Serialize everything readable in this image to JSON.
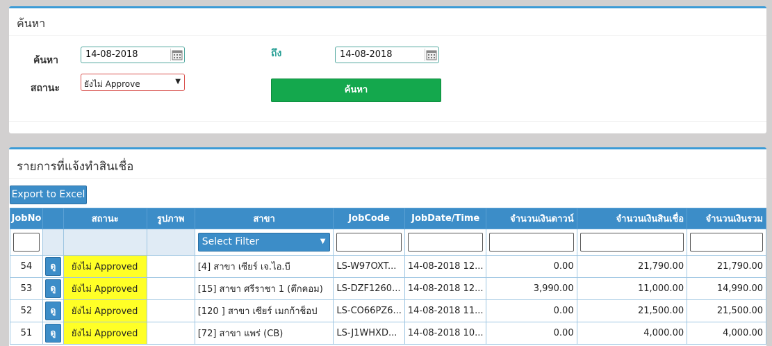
{
  "search_panel": {
    "title": "ค้นหา",
    "from_label": "ค้นหา",
    "from_date": "14-08-2018",
    "to_label": "ถึง",
    "to_date": "14-08-2018",
    "status_label": "สถานะ",
    "status_value": "ยังไม่ Approve",
    "search_button": "ค้นหา"
  },
  "list_panel": {
    "title": "รายการที่แจ้งทำสินเชื่อ",
    "export_button": "Export to Excel",
    "columns": [
      "JobNo",
      "สถานะ",
      "รูปภาพ",
      "สาขา",
      "JobCode",
      "JobDate/Time",
      "จำนวนเงินดาวน์",
      "จำนวนเงินสินเชื่อ",
      "จำนวนเงินรวม"
    ],
    "filter_placeholder": "Select Filter",
    "view_button": "ดู",
    "rows": [
      {
        "job_no": "54",
        "status": "ยังไม่ Approved",
        "branch": "[4] สาขา เซียร์ เจ.ไอ.บี",
        "job_code": "LS-W97OXT...",
        "job_date": "14-08-2018 12...",
        "down": "0.00",
        "loan": "21,790.00",
        "total": "21,790.00"
      },
      {
        "job_no": "53",
        "status": "ยังไม่ Approved",
        "branch": "[15] สาขา ศรีราชา 1 (ตึกคอม)",
        "job_code": "LS-DZF1260...",
        "job_date": "14-08-2018 12...",
        "down": "3,990.00",
        "loan": "11,000.00",
        "total": "14,990.00"
      },
      {
        "job_no": "52",
        "status": "ยังไม่ Approved",
        "branch": "[120 ] สาขา เซียร์ เมกก้าช็อป",
        "job_code": "LS-CO66PZ6...",
        "job_date": "14-08-2018 11...",
        "down": "0.00",
        "loan": "21,500.00",
        "total": "21,500.00"
      },
      {
        "job_no": "51",
        "status": "ยังไม่ Approved",
        "branch": "[72] สาขา แพร่ (CB)",
        "job_code": "LS-J1WHXD...",
        "job_date": "14-08-2018 10...",
        "down": "0.00",
        "loan": "4,000.00",
        "total": "4,000.00"
      }
    ]
  },
  "colors": {
    "accent_blue": "#3c8dc8",
    "search_green": "#14a84d",
    "status_yellow": "#ffff26",
    "label_teal": "#2aa096"
  }
}
